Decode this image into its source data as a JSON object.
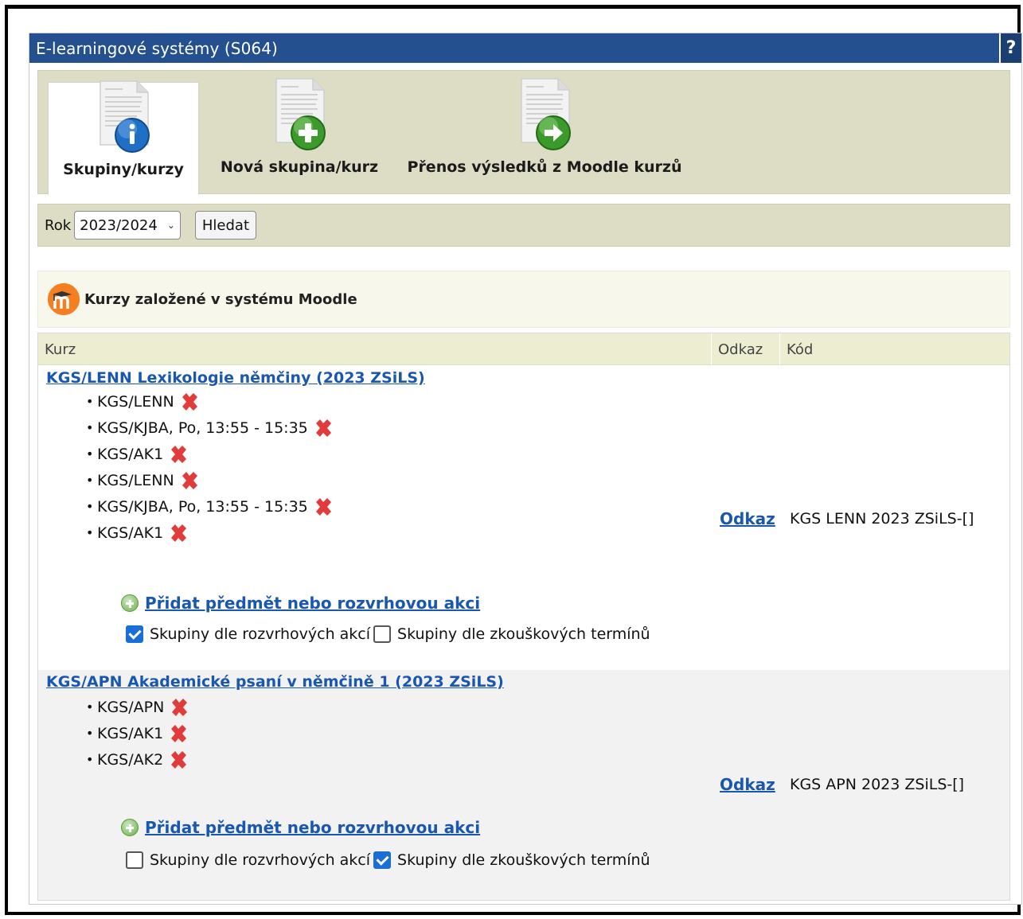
{
  "window": {
    "title": "E-learningové systémy (S064)",
    "help": "?"
  },
  "toolbar": {
    "items": [
      {
        "label": "Skupiny/kurzy",
        "icon": "info-badge-icon",
        "active": true
      },
      {
        "label": "Nová skupina/kurz",
        "icon": "add-badge-icon",
        "active": false
      },
      {
        "label": "Přenos výsledků z Moodle kurzů",
        "icon": "arrow-badge-icon",
        "active": false
      }
    ]
  },
  "search": {
    "year_label": "Rok",
    "year_value": "2023/2024",
    "search_button": "Hledat"
  },
  "section": {
    "title": "Kurzy založené v systému Moodle",
    "icon": "moodle-icon"
  },
  "table": {
    "columns": [
      "Kurz",
      "Odkaz",
      "Kód"
    ],
    "rows": [
      {
        "course": "KGS/LENN Lexikologie němčiny (2023 ZSiLS)",
        "items": [
          "KGS/LENN",
          "KGS/KJBA, Po, 13:55 - 15:35",
          "KGS/AK1",
          "KGS/LENN",
          "KGS/KJBA, Po, 13:55 - 15:35",
          "KGS/AK1"
        ],
        "add_link": "Přidat předmět nebo rozvrhovou akci",
        "check1": {
          "label": "Skupiny dle rozvrhových akcí",
          "checked": true
        },
        "check2": {
          "label": "Skupiny dle zkouškových termínů",
          "checked": false
        },
        "link": "Odkaz",
        "code": "KGS LENN 2023 ZSiLS-[]"
      },
      {
        "course": "KGS/APN Akademické psaní v němčině 1 (2023 ZSiLS)",
        "items": [
          "KGS/APN",
          "KGS/AK1",
          "KGS/AK2"
        ],
        "add_link": "Přidat předmět nebo rozvrhovou akci",
        "check1": {
          "label": "Skupiny dle rozvrhových akcí",
          "checked": false
        },
        "check2": {
          "label": "Skupiny dle zkouškových termínů",
          "checked": true
        },
        "link": "Odkaz",
        "code": "KGS APN 2023 ZSiLS-[]"
      }
    ]
  },
  "colors": {
    "titlebar": "#24508f",
    "toolbar_bg": "#dddcc4",
    "link": "#1a57b0",
    "moodle": "#f57f20",
    "delete": "#e23b3b"
  }
}
